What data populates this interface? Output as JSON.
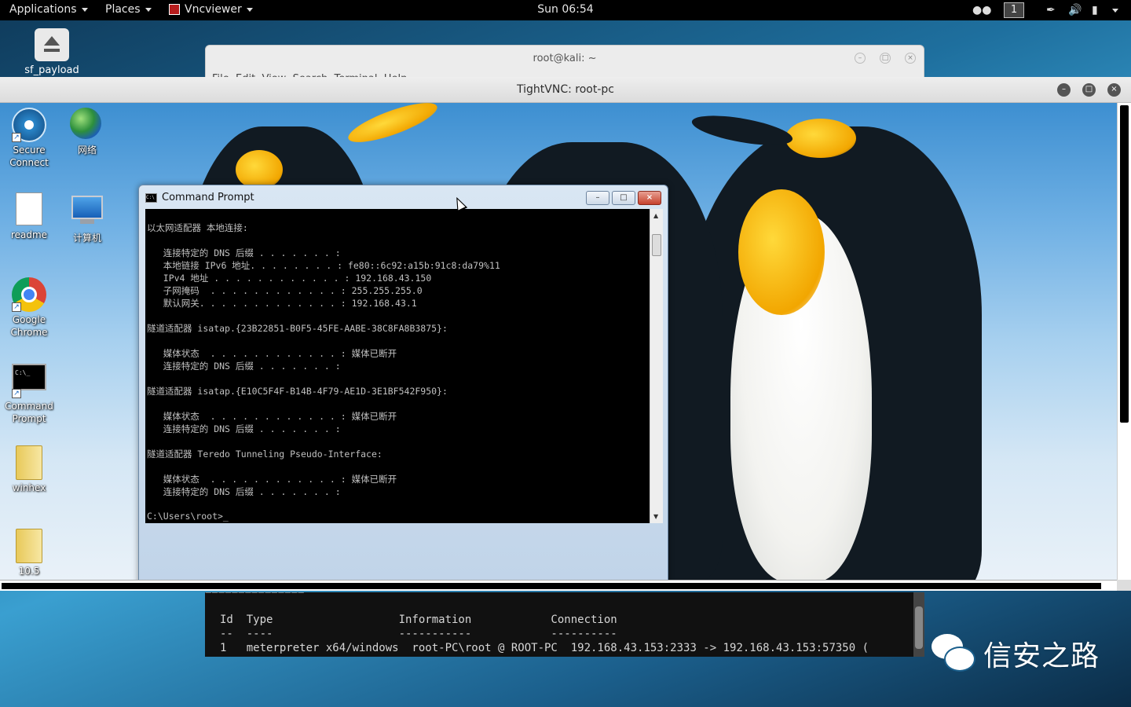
{
  "topbar": {
    "applications": "Applications",
    "places": "Places",
    "app_name": "Vncviewer",
    "clock": "Sun 06:54",
    "workspace": "1"
  },
  "kali_desktop": {
    "icon_label": "sf_payload"
  },
  "kali_terminal": {
    "title": "root@kali: ~",
    "menu_partial": "File  Edit  View  Search  Terminal  Help"
  },
  "vnc": {
    "title": "TightVNC: root-pc"
  },
  "win_desktop": {
    "icons": [
      {
        "label": "Secure Connect"
      },
      {
        "label": "网络"
      },
      {
        "label": "readme"
      },
      {
        "label": "计算机"
      },
      {
        "label": "Google Chrome"
      },
      {
        "label": "Command Prompt"
      },
      {
        "label": "winhex"
      },
      {
        "label": "10.5"
      }
    ]
  },
  "cmd": {
    "title": "Command Prompt",
    "lines": [
      "以太网适配器 本地连接:",
      "",
      "   连接特定的 DNS 后缀 . . . . . . . :",
      "   本地链接 IPv6 地址. . . . . . . . : fe80::6c92:a15b:91c8:da79%11",
      "   IPv4 地址 . . . . . . . . . . . . : 192.168.43.150",
      "   子网掩码  . . . . . . . . . . . . : 255.255.255.0",
      "   默认网关. . . . . . . . . . . . . : 192.168.43.1",
      "",
      "隧道适配器 isatap.{23B22851-B0F5-45FE-AABE-38C8FA8B3875}:",
      "",
      "   媒体状态  . . . . . . . . . . . . : 媒体已断开",
      "   连接特定的 DNS 后缀 . . . . . . . :",
      "",
      "隧道适配器 isatap.{E10C5F4F-B14B-4F79-AE1D-3E1BF542F950}:",
      "",
      "   媒体状态  . . . . . . . . . . . . : 媒体已断开",
      "   连接特定的 DNS 后缀 . . . . . . . :",
      "",
      "隧道适配器 Teredo Tunneling Pseudo-Interface:",
      "",
      "   媒体状态  . . . . . . . . . . . . : 媒体已断开",
      "   连接特定的 DNS 后缀 . . . . . . . :",
      "",
      "C:\\Users\\root>_"
    ]
  },
  "msf": {
    "lines": [
      "===============",
      "",
      "Id  Type                   Information            Connection",
      "--  ----                   -----------            ----------",
      "1   meterpreter x64/windows  root-PC\\root @ ROOT-PC  192.168.43.153:2333 -> 192.168.43.153:57350 ("
    ]
  },
  "watermark": {
    "text": "信安之路"
  }
}
